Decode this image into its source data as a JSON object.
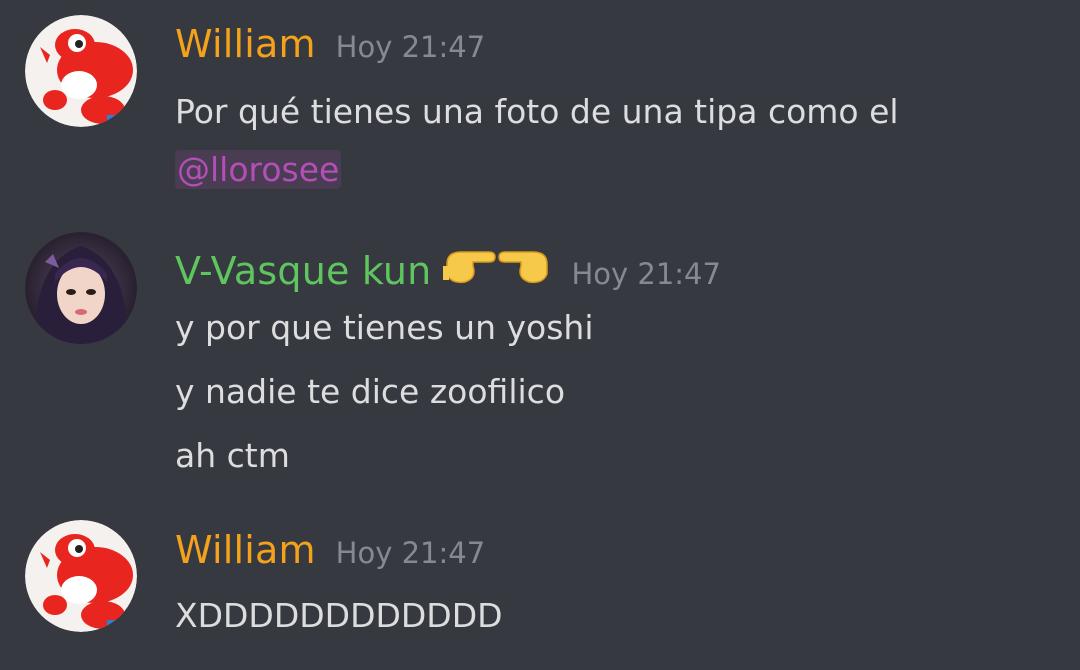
{
  "messages": [
    {
      "author": "William",
      "author_color": "#f4a21b",
      "avatar": "yoshi-avatar",
      "timestamp": "Hoy 21:47",
      "lines": [
        "Por qué tienes una foto de una tipa como el"
      ],
      "mention": "@llorosee"
    },
    {
      "author": "V-Vasque kun",
      "author_color": "#5fc55f",
      "avatar": "girl-photo-avatar",
      "emoji": "pointing-hands-emoji",
      "timestamp": "Hoy 21:47",
      "lines": [
        "y por que tienes un yoshi",
        "y nadie te dice zoofilico",
        "ah ctm"
      ]
    },
    {
      "author": "William",
      "author_color": "#f4a21b",
      "avatar": "yoshi-avatar",
      "timestamp": "Hoy 21:47",
      "lines": [
        "XDDDDDDDDDDDD"
      ]
    }
  ],
  "colors": {
    "background": "#36393f",
    "text": "#dcddde",
    "timestamp": "#868a90",
    "mention": "#b44fb8"
  }
}
